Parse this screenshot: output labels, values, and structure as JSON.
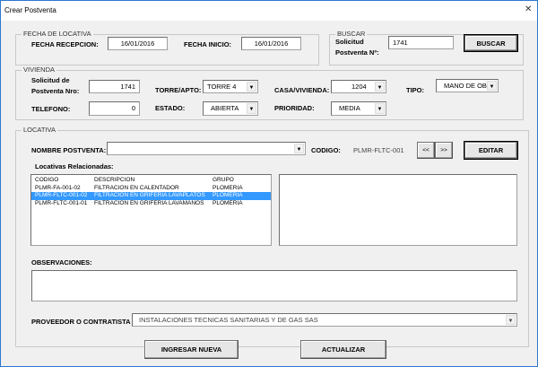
{
  "window": {
    "title": "Crear Postventa",
    "close": "✕"
  },
  "fecha": {
    "legend": "FECHA DE LOCATIVA",
    "recepcion_label": "FECHA RECEPCION:",
    "recepcion_value": "16/01/2016",
    "inicio_label": "FECHA INICIO:",
    "inicio_value": "16/01/2016"
  },
  "buscar": {
    "legend": "BUSCAR",
    "label1": "Solicitud",
    "label2": "Postventa Nº:",
    "value": "1741",
    "button": "BUSCAR"
  },
  "vivienda": {
    "legend": "VIVIENDA",
    "solicitud_label1": "Solicitud de",
    "solicitud_label2": "Postventa Nro:",
    "solicitud_value": "1741",
    "torre_label": "TORRE/APTO:",
    "torre_value": "TORRE 4",
    "casa_label": "CASA/VIVIENDA:",
    "casa_value": "1204",
    "tipo_label": "TIPO:",
    "tipo_value": "MANO DE OBR.",
    "telefono_label": "TELEFONO:",
    "telefono_value": "0",
    "estado_label": "ESTADO:",
    "estado_value": "ABIERTA",
    "prioridad_label": "PRIORIDAD:",
    "prioridad_value": "MEDIA"
  },
  "locativa": {
    "legend": "LOCATIVA",
    "nombre_label": "NOMBRE POSTVENTA:",
    "nombre_value": "",
    "codigo_label": "CODIGO:",
    "codigo_value": "PLMR-FLTC-001",
    "prev": "<<",
    "next": ">>",
    "editar": "EDITAR",
    "relacionadas_label": "Locativas Relacionadas:",
    "list": {
      "headers": [
        "CODIGO",
        "DESCRIPCION",
        "GRUPO"
      ],
      "rows": [
        [
          "PLMR-FA-001-02",
          "FILTRACION EN CALENTADOR",
          "PLOMERIA"
        ],
        [
          "PLMR-FLTC-001-02",
          "FILTRACION EN GRIFERIA LAVAPLATOS",
          "PLOMERIA"
        ],
        [
          "PLMR-FLTC-001-01",
          "FILTRACION EN GRIFERIA LAVAMANOS",
          "PLOMERIA"
        ]
      ],
      "selected_index": 1
    },
    "observaciones_label": "OBSERVACIONES:",
    "observaciones_value": "",
    "proveedor_label": "PROVEEDOR O CONTRATISTA",
    "proveedor_value": "INSTALACIONES TECNICAS SANITARIAS Y DE GAS SAS"
  },
  "actions": {
    "ingresar": "INGRESAR NUEVA",
    "actualizar": "ACTUALIZAR"
  },
  "icons": {
    "dropdown": "▼"
  }
}
